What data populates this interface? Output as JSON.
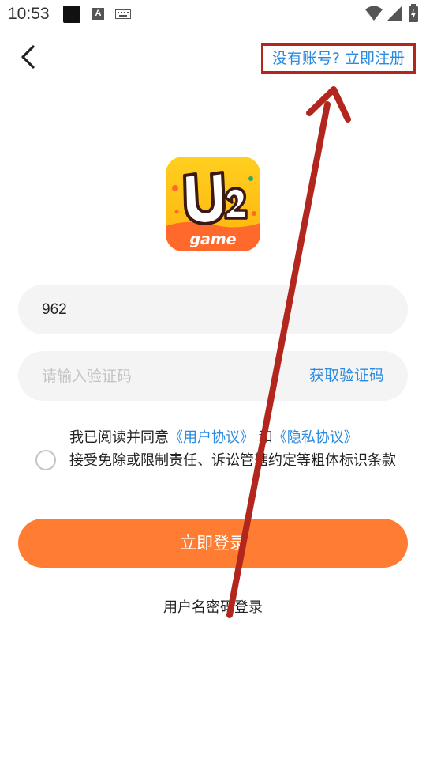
{
  "status_bar": {
    "time": "10:53",
    "a_label": "A",
    "icons": [
      "black-square-icon",
      "a-icon",
      "keyboard-icon",
      "wifi-icon",
      "signal-icon",
      "battery-icon"
    ]
  },
  "header": {
    "back_icon": "chevron-left-icon",
    "register_text": "没有账号? 立即注册"
  },
  "logo": {
    "text_main": "U2",
    "text_sub": "game"
  },
  "form": {
    "phone_value": "962",
    "code_placeholder": "请输入验证码",
    "get_code_label": "获取验证码"
  },
  "agreement": {
    "prefix": "我已阅读并同意",
    "user_agreement": "《用户协议》",
    "and": "和",
    "privacy_agreement": "《隐私协议》",
    "suffix": "接受免除或限制责任、诉讼管辖约定等粗体标识条款"
  },
  "login_button": "立即登录",
  "password_login": "用户名密码登录",
  "colors": {
    "accent_orange": "#ff7d33",
    "link_blue": "#2a8be0",
    "annotation_red": "#b3261e"
  }
}
